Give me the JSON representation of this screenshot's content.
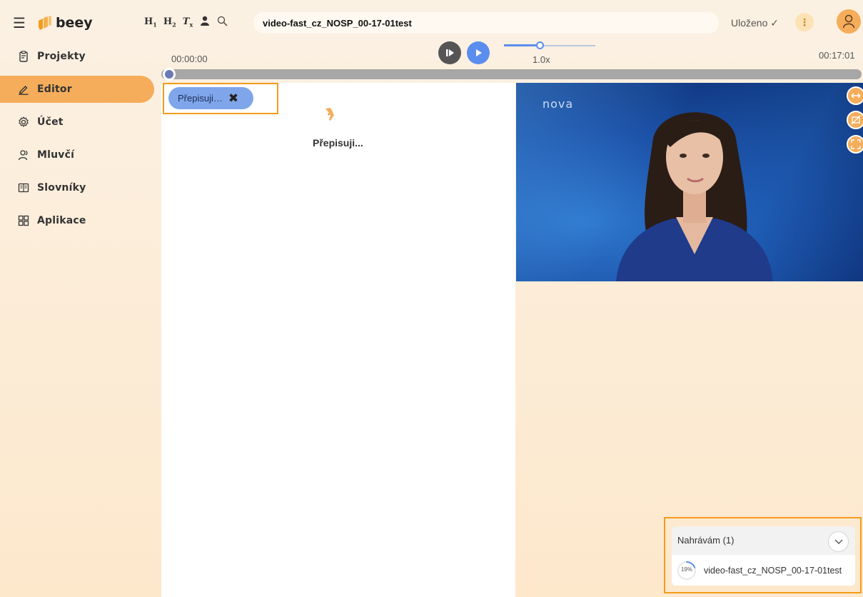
{
  "app": {
    "brand": "beey"
  },
  "sidebar": {
    "items": [
      {
        "label": "Projekty",
        "icon": "projects-icon",
        "active": false
      },
      {
        "label": "Editor",
        "icon": "edit-pen-icon",
        "active": true
      },
      {
        "label": "Účet",
        "icon": "settings-gear-icon",
        "active": false
      },
      {
        "label": "Mluvčí",
        "icon": "speakers-icon",
        "active": false
      },
      {
        "label": "Slovníky",
        "icon": "dictionary-icon",
        "active": false
      },
      {
        "label": "Aplikace",
        "icon": "apps-grid-icon",
        "active": false
      }
    ]
  },
  "toolbar": {
    "heading1_label": "H",
    "heading1_sub": "1",
    "heading2_label": "H",
    "heading2_sub": "2",
    "clear_format_label": "T",
    "clear_format_sub": "x",
    "project_title": "video-fast_cz_NOSP_00-17-01test",
    "saved_status": "Uloženo ✓"
  },
  "player": {
    "current_time": "00:00:00",
    "total_time": "00:17:01",
    "speed_label": "1.0x",
    "speed_fraction": 0.39,
    "progress_fraction": 0.0
  },
  "editor": {
    "status_chip_label": "Přepisuji…",
    "progress_message": "Přepisuji..."
  },
  "video": {
    "channel_watermark": "nova"
  },
  "uploads": {
    "header": "Nahrávám (1)",
    "items": [
      {
        "percent_label": "19%",
        "percent": 19,
        "name": "video-fast_cz_NOSP_00-17-01test"
      }
    ]
  },
  "colors": {
    "accent_orange": "#f5ad5b",
    "highlight_orange": "#f39c1d",
    "play_blue": "#5b8def",
    "chip_blue": "#7fa6ea"
  }
}
